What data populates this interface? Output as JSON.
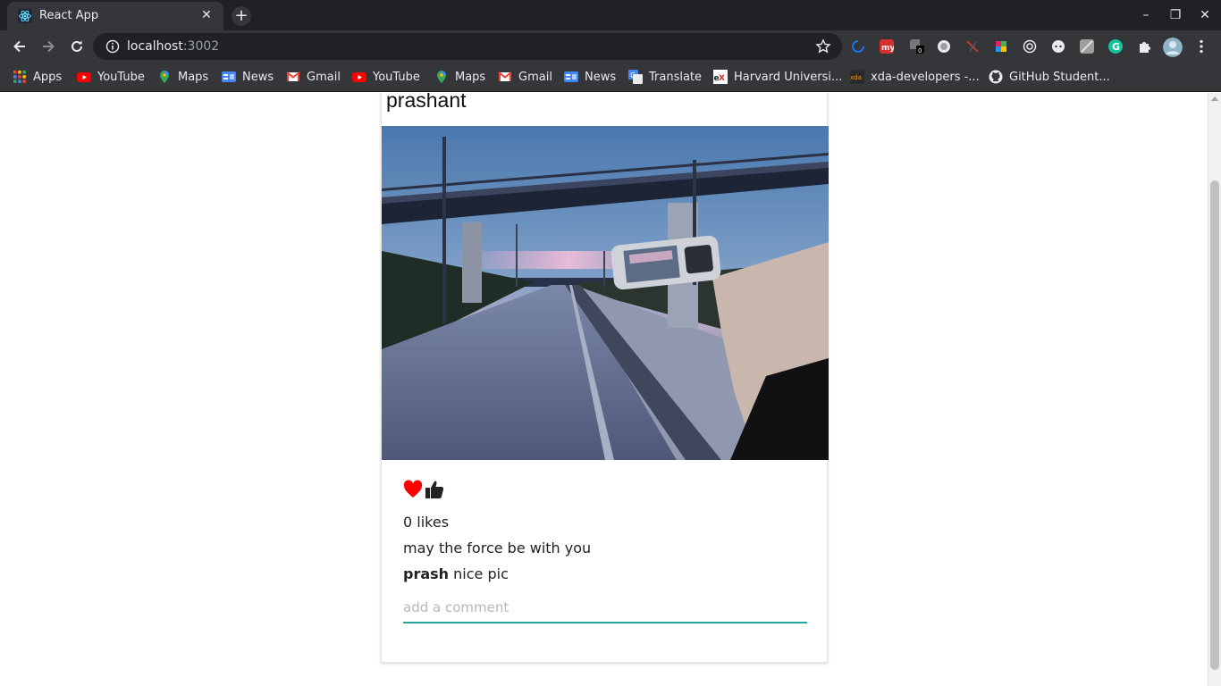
{
  "browser": {
    "tab_title": "React App",
    "tab_close": "✕",
    "new_tab": "+",
    "url_host": "localhost",
    "url_port": ":3002",
    "window_controls": {
      "minimize": "–",
      "maximize": "❐",
      "close": "✕"
    }
  },
  "bookmarks": [
    {
      "label": "Apps",
      "icon": "apps-grid-icon"
    },
    {
      "label": "YouTube",
      "icon": "youtube-icon"
    },
    {
      "label": "Maps",
      "icon": "maps-icon"
    },
    {
      "label": "News",
      "icon": "news-icon"
    },
    {
      "label": "Gmail",
      "icon": "gmail-icon"
    },
    {
      "label": "YouTube",
      "icon": "youtube-icon"
    },
    {
      "label": "Maps",
      "icon": "maps-icon"
    },
    {
      "label": "Gmail",
      "icon": "gmail-icon"
    },
    {
      "label": "News",
      "icon": "news-icon"
    },
    {
      "label": "Translate",
      "icon": "translate-icon"
    },
    {
      "label": "Harvard Universi...",
      "icon": "edx-icon"
    },
    {
      "label": "xda-developers -...",
      "icon": "xda-icon"
    },
    {
      "label": "GitHub Student...",
      "icon": "github-icon"
    }
  ],
  "post": {
    "username": "prashant",
    "likes_text": "0 likes",
    "caption": "may the force be with you",
    "comment": {
      "author": "prash",
      "text": "nice pic"
    },
    "comment_placeholder": "add a comment",
    "image_alt": "hand holding a phone photographing a road under an overpass at dusk"
  },
  "colors": {
    "accent": "#26a69a",
    "heart": "#ff0000",
    "thumb": "#222222"
  }
}
